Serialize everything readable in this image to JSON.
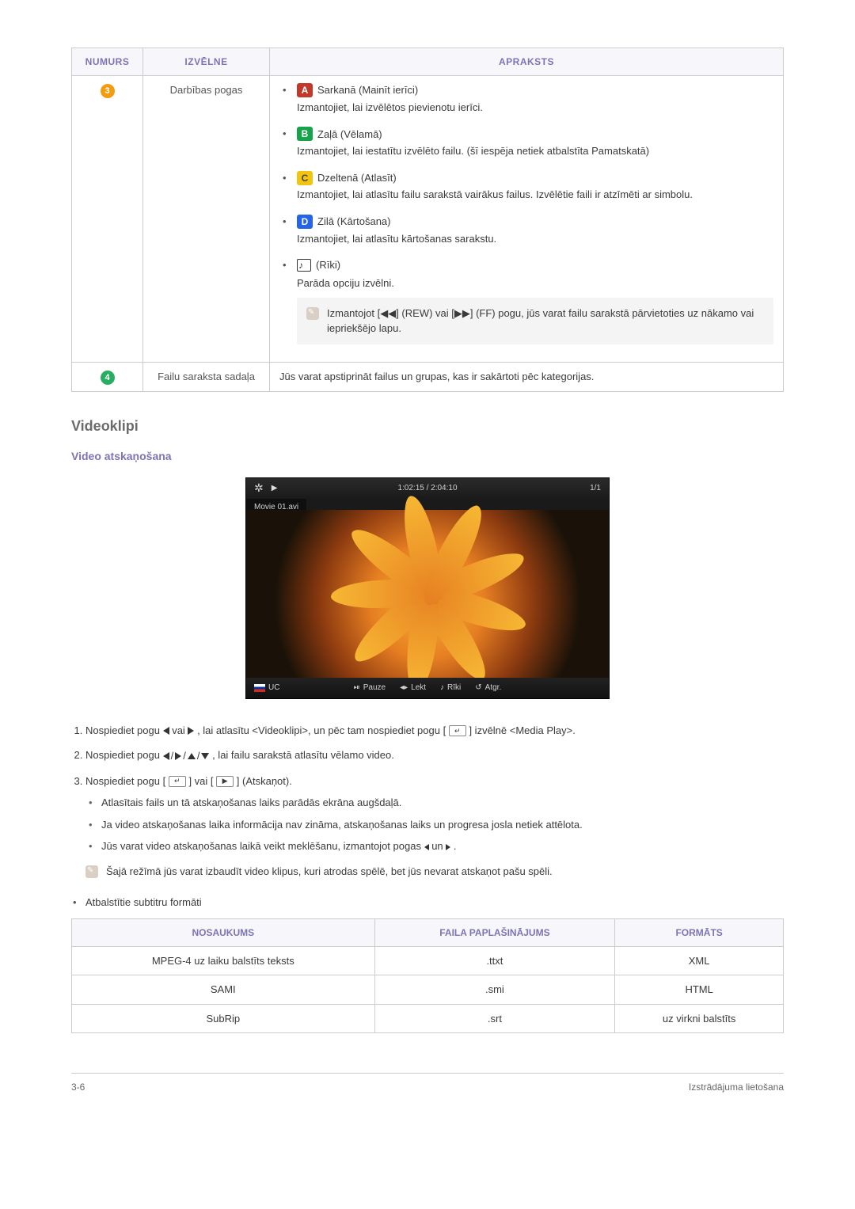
{
  "main_table": {
    "headers": {
      "num": "NUMURS",
      "menu": "IZVĒLNE",
      "desc": "APRAKSTS"
    },
    "row3": {
      "num": "3",
      "menu": "Darbības pogas",
      "buttons": [
        {
          "key": "A",
          "label": "Sarkanā (Mainīt ierīci)",
          "desc": "Izmantojiet, lai izvēlētos pievienotu ierīci."
        },
        {
          "key": "B",
          "label": "Zaļā (Vēlamā)",
          "desc": "Izmantojiet, lai iestatītu izvēlēto failu. (šī iespēja netiek atbalstīta Pamatskatā)"
        },
        {
          "key": "C",
          "label": "Dzeltenā (Atlasīt)",
          "desc": "Izmantojiet, lai atlasītu failu sarakstā vairākus failus. Izvēlētie faili ir atzīmēti ar simbolu."
        },
        {
          "key": "D",
          "label": "Zilā (Kārtošana)",
          "desc": "Izmantojiet, lai atlasītu kārtošanas sarakstu."
        },
        {
          "key": "TOOLS",
          "label": "(Rīki)",
          "desc": "Parāda opciju izvēlni."
        }
      ],
      "note": "Izmantojot [◀◀] (REW) vai [▶▶] (FF) pogu, jūs varat failu sarakstā pārvietoties uz nākamo vai iepriekšējo lapu."
    },
    "row4": {
      "num": "4",
      "menu": "Failu saraksta sadaļa",
      "desc": "Jūs varat apstiprināt failus un grupas, kas ir sakārtoti pēc kategorijas."
    }
  },
  "video_section": {
    "title": "Videoklipi",
    "subtitle": "Video atskaņošana",
    "player": {
      "time": "1:02:15 / 2:04:10",
      "index": "1/1",
      "filename": "Movie 01.avi",
      "lang": "UC",
      "pause": "Pauze",
      "jump": "Lekt",
      "tools": "Rīki",
      "return": "Atgr."
    }
  },
  "steps": {
    "s1_a": "Nospiediet pogu ",
    "s1_b": " vai ",
    "s1_c": ", lai atlasītu <Videoklipi>, un pēc tam nospiediet pogu [",
    "s1_d": "] izvēlnē <Media Play>.",
    "s2_a": "Nospiediet pogu ",
    "s2_b": ", lai failu sarakstā atlasītu vēlamo video.",
    "s3_a": "Nospiediet pogu [",
    "s3_b": "] vai [",
    "s3_c": "] (Atskaņot).",
    "s3_sub1": "Atlasītais fails un tā atskaņošanas laiks parādās ekrāna augšdaļā.",
    "s3_sub2": "Ja video atskaņošanas laika informācija nav zināma, atskaņošanas laiks un progresa josla netiek attēlota.",
    "s3_sub3_a": "Jūs varat video atskaņošanas laikā veikt meklēšanu, izmantojot pogas ",
    "s3_sub3_b": " un ",
    "s3_sub3_c": ".",
    "note": "Šajā režīmā jūs varat izbaudīt video klipus, kuri atrodas spēlē, bet jūs nevarat atskaņot pašu spēli."
  },
  "subs": {
    "intro": "Atbalstītie subtitru formāti",
    "headers": {
      "name": "NOSAUKUMS",
      "ext": "FAILA PAPLAŠINĀJUMS",
      "fmt": "FORMĀTS"
    },
    "rows": [
      {
        "name": "MPEG-4 uz laiku balstīts teksts",
        "ext": ".ttxt",
        "fmt": "XML"
      },
      {
        "name": "SAMI",
        "ext": ".smi",
        "fmt": "HTML"
      },
      {
        "name": "SubRip",
        "ext": ".srt",
        "fmt": "uz virkni balstīts"
      }
    ]
  },
  "footer": {
    "left": "3-6",
    "right": "Izstrādājuma lietošana"
  }
}
